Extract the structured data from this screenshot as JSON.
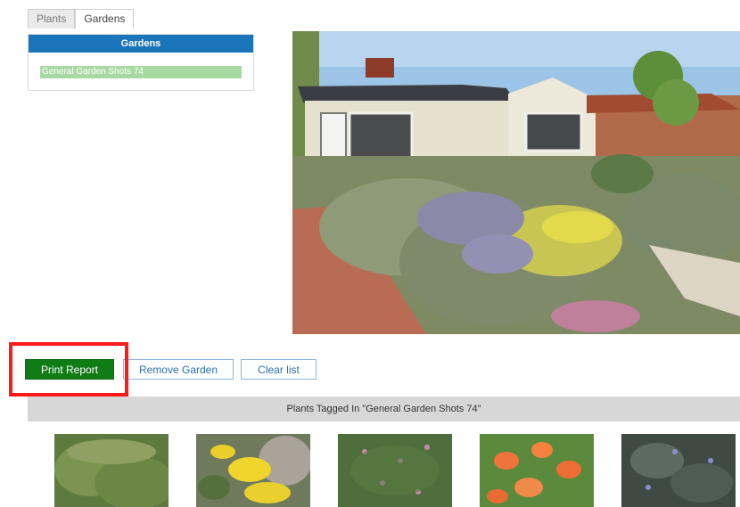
{
  "tabs": [
    {
      "label": "Plants",
      "active": false
    },
    {
      "label": "Gardens",
      "active": true
    }
  ],
  "gardens_panel": {
    "header": "Gardens",
    "items": [
      "General Garden Shots 74"
    ]
  },
  "actions": {
    "print_label": "Print Report",
    "remove_label": "Remove Garden",
    "clear_label": "Clear list"
  },
  "tagged_section": {
    "title": "Plants Tagged In \"General Garden Shots 74\""
  },
  "colors": {
    "header_blue": "#1b75bb",
    "selected_item": "#a9d9a2",
    "print_button": "#0f7c16",
    "highlight": "#ff1a1a"
  }
}
